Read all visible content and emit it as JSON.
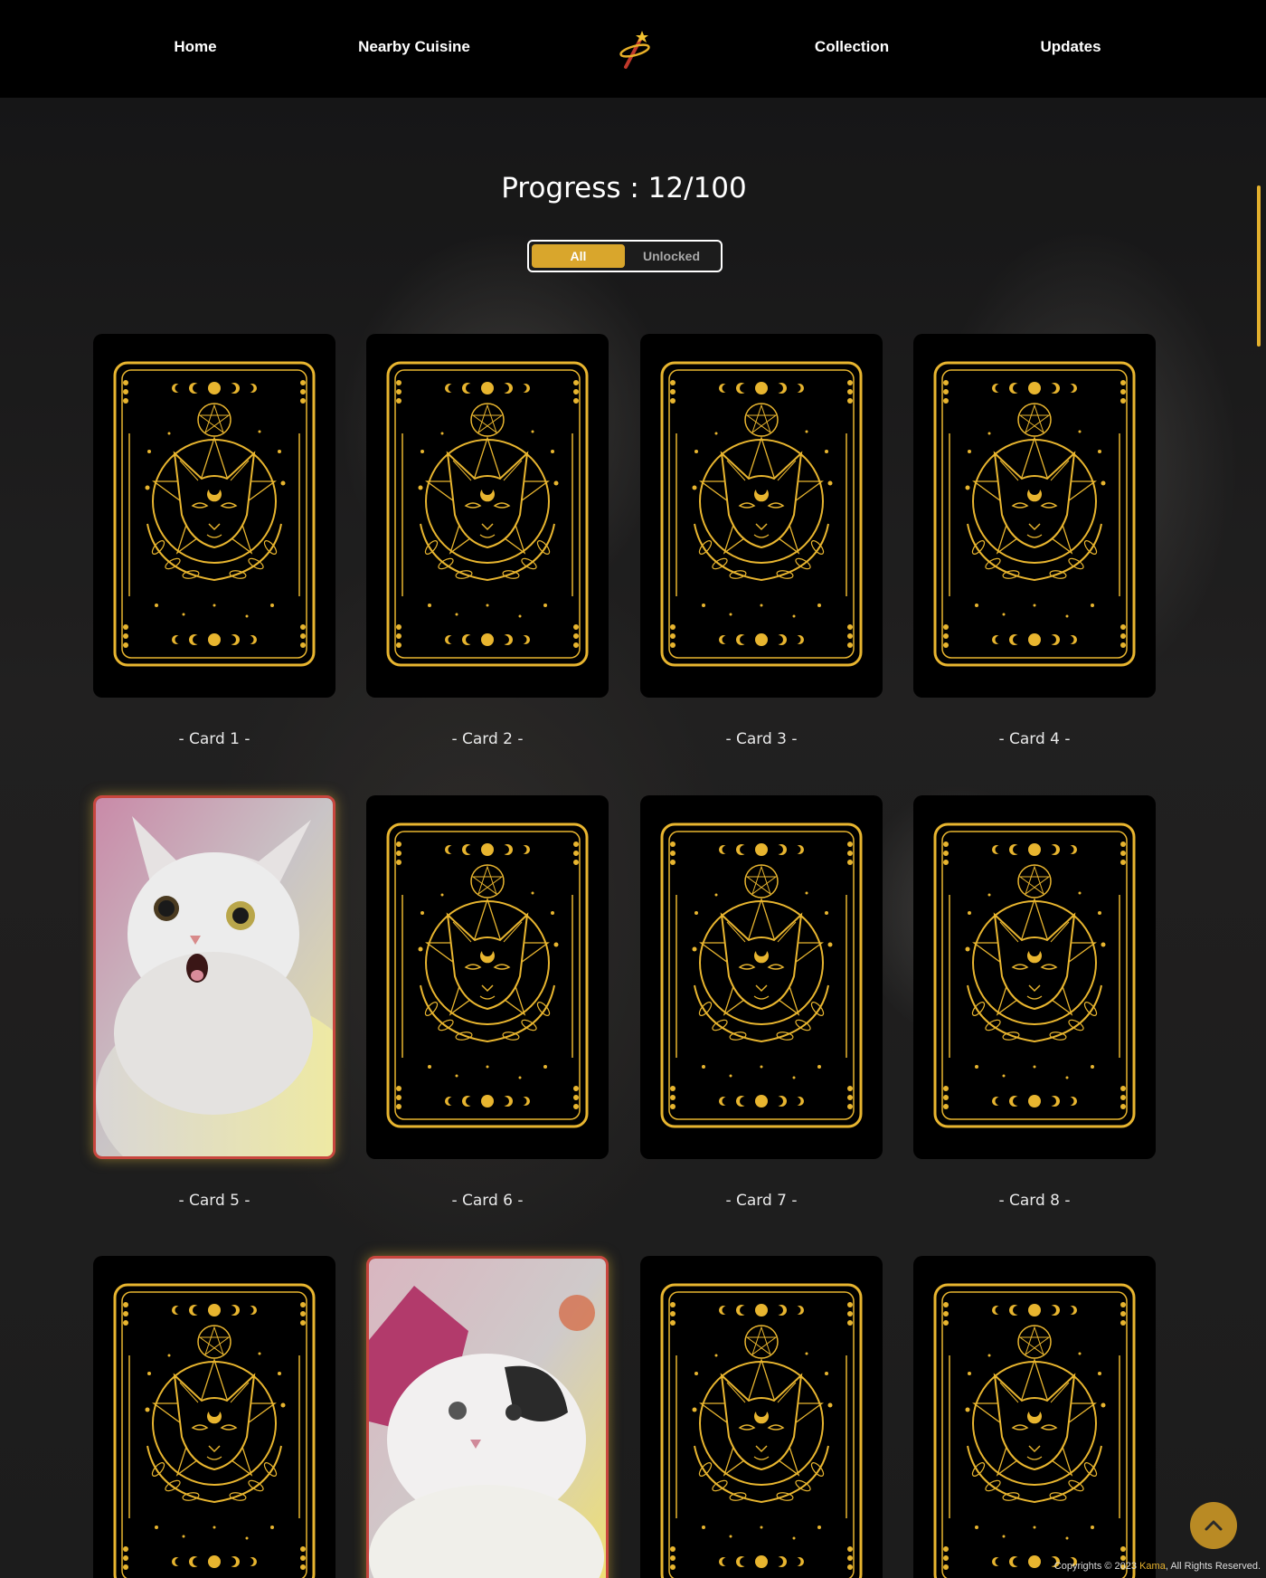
{
  "nav": {
    "items": [
      {
        "label": "Home"
      },
      {
        "label": "Nearby Cuisine"
      },
      {
        "label": "Collection"
      },
      {
        "label": "Updates"
      }
    ],
    "logo_icon": "wand-ring-logo-icon"
  },
  "main": {
    "progress_text": "Progress : 12/100",
    "progress": {
      "unlocked": 12,
      "total": 100
    },
    "filter": {
      "options": [
        "All",
        "Unlocked"
      ],
      "selected": "All"
    },
    "cards": [
      {
        "label": "-  Card 1  -",
        "state": "locked"
      },
      {
        "label": "-  Card 2  -",
        "state": "locked"
      },
      {
        "label": "-  Card 3  -",
        "state": "locked"
      },
      {
        "label": "-  Card 4  -",
        "state": "locked"
      },
      {
        "label": "-  Card 5  -",
        "state": "unlocked",
        "image": "white-cat-photo"
      },
      {
        "label": "-  Card 6  -",
        "state": "locked"
      },
      {
        "label": "-  Card 7  -",
        "state": "locked"
      },
      {
        "label": "-  Card 8  -",
        "state": "locked"
      },
      {
        "label": "",
        "state": "locked"
      },
      {
        "label": "",
        "state": "unlocked",
        "image": "calico-cat-photo"
      },
      {
        "label": "",
        "state": "locked"
      },
      {
        "label": "",
        "state": "locked"
      }
    ]
  },
  "footer": {
    "prefix": "Copyrights © 2023 ",
    "brand": "Kama",
    "suffix": ", All Rights Reserved."
  },
  "colors": {
    "accent_gold": "#e3b02d",
    "card_back": "#000000",
    "unlocked_border": "#c8463e"
  },
  "icons": {
    "back_to_top": "chevron-up-icon",
    "card_back_art": "tarot-cat-moon-icon"
  }
}
